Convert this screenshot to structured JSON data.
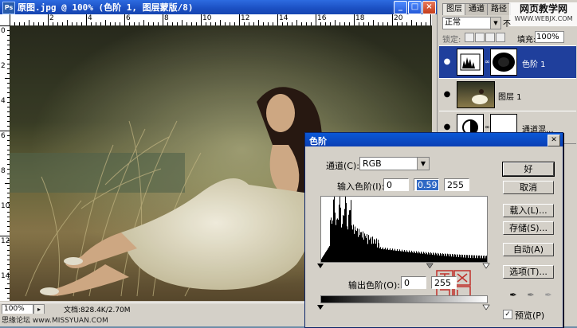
{
  "document": {
    "title": "原图.jpg @ 100% (色阶 1, 图层蒙版/8)",
    "zoom": "100%",
    "doc_size": "文档:828.4K/2.70M",
    "ruler_h": [
      "2",
      "4",
      "6",
      "8",
      "10",
      "12",
      "14",
      "16",
      "18",
      "20",
      "22"
    ],
    "ruler_v": [
      "0",
      "2",
      "4",
      "6",
      "8",
      "10",
      "12",
      "14"
    ]
  },
  "watermark_left": "思缘论坛 www.MISSYUAN.COM",
  "layers_panel": {
    "tabs": [
      "图层",
      "通道",
      "路径"
    ],
    "blend_mode": "正常",
    "opacity_label": "不",
    "lock_label": "锁定:",
    "fill_label": "填充:",
    "fill_value": "100%",
    "layers": [
      {
        "name": "色阶 1",
        "selected": true
      },
      {
        "name": "图层 1",
        "selected": false
      },
      {
        "name": "通道混...",
        "selected": false
      }
    ]
  },
  "site_watermark": {
    "line1": "网页教学网",
    "line2": "WWW.WEBJX.COM"
  },
  "levels_dialog": {
    "title": "色阶",
    "channel_label": "通道(C):",
    "channel_value": "RGB",
    "input_label": "输入色阶(I):",
    "input_black": "0",
    "input_gamma": "0.59",
    "input_white": "255",
    "output_label": "输出色阶(O):",
    "output_black": "0",
    "output_white": "255",
    "buttons": {
      "ok": "好",
      "cancel": "取消",
      "load": "载入(L)...",
      "save": "存储(S)...",
      "auto": "自动(A)",
      "options": "选项(T)..."
    },
    "preview_label": "预览(P)",
    "preview_checked": true,
    "seal_text": "自然相机",
    "gamma_slider_position": 0.66
  },
  "icons": {
    "eye": "eye-icon",
    "close": "close-icon",
    "eyedropper": "eyedropper-icon"
  }
}
